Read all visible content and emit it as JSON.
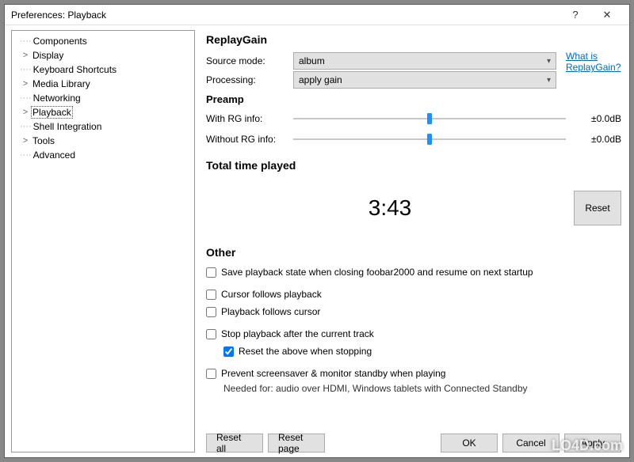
{
  "window": {
    "title": "Preferences: Playback",
    "help_label": "?",
    "close_label": "✕"
  },
  "tree": {
    "items": [
      {
        "label": "Components",
        "expandable": false
      },
      {
        "label": "Display",
        "expandable": true
      },
      {
        "label": "Keyboard Shortcuts",
        "expandable": false
      },
      {
        "label": "Media Library",
        "expandable": true
      },
      {
        "label": "Networking",
        "expandable": false
      },
      {
        "label": "Playback",
        "expandable": true,
        "selected": true
      },
      {
        "label": "Shell Integration",
        "expandable": false
      },
      {
        "label": "Tools",
        "expandable": true
      },
      {
        "label": "Advanced",
        "expandable": false
      }
    ]
  },
  "replaygain": {
    "title": "ReplayGain",
    "source_label": "Source mode:",
    "source_value": "album",
    "processing_label": "Processing:",
    "processing_value": "apply gain",
    "link_text": "What is ReplayGain?"
  },
  "preamp": {
    "title": "Preamp",
    "with_label": "With RG info:",
    "with_value": "±0.0dB",
    "with_pos_pct": 50,
    "without_label": "Without RG info:",
    "without_value": "±0.0dB",
    "without_pos_pct": 50
  },
  "total_time": {
    "title": "Total time played",
    "value": "3:43",
    "reset_label": "Reset"
  },
  "other": {
    "title": "Other",
    "save_state_label": "Save playback state when closing foobar2000 and resume on next startup",
    "cursor_follows_label": "Cursor follows playback",
    "playback_follows_label": "Playback follows cursor",
    "stop_after_label": "Stop playback after the current track",
    "reset_above_label": "Reset the above when stopping",
    "prevent_ss_label": "Prevent screensaver & monitor standby when playing",
    "prevent_ss_hint": "Needed for: audio over HDMI, Windows tablets with Connected Standby"
  },
  "buttons": {
    "reset_all": "Reset all",
    "reset_page": "Reset page",
    "ok": "OK",
    "cancel": "Cancel",
    "apply": "Apply"
  },
  "watermark": "LO4D.com"
}
